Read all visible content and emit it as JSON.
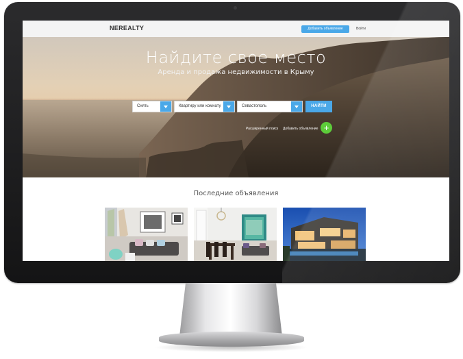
{
  "nav": {
    "logo": "NEREALTY",
    "add_button": "Добавить объявление",
    "login": "Войти"
  },
  "hero": {
    "title": "Найдите свое место",
    "subtitle": "Аренда и продажа недвижимости в Крыму"
  },
  "search": {
    "deal_type": "Снять",
    "property_type": "Квартиру или комнату",
    "city": "Севастополь",
    "find_button": "НАЙТИ"
  },
  "links": {
    "advanced_search": "Расширенный поиск",
    "add_listing": "Добавить объявление"
  },
  "latest": {
    "title": "Последние объявления"
  },
  "colors": {
    "accent": "#4aa8e8",
    "plus": "#5dcc3a"
  },
  "icons": {
    "plus": "plus-icon",
    "dropdown": "chevron-down-icon"
  }
}
